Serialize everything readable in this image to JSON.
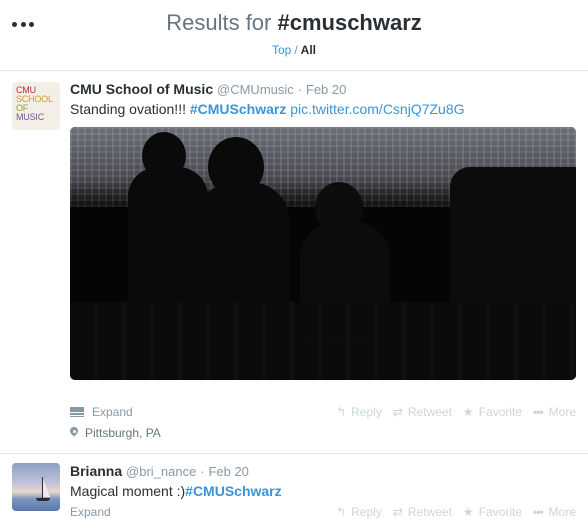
{
  "header": {
    "title_prefix": "Results for ",
    "title_query": "#cmuschwarz",
    "tabs": [
      {
        "label": "Top"
      },
      {
        "label": "All"
      }
    ],
    "tab_separator": "/"
  },
  "tweets": [
    {
      "avatar_lines": [
        "CMU",
        "SCHOOL",
        "OF",
        "MUSIC"
      ],
      "fullname": "CMU School of Music",
      "username": "@CMUmusic",
      "dot": "·",
      "time": "Feb 20",
      "text_before": "Standing ovation!!! ",
      "hashtag": "#CMUSchwarz",
      "link": "pic.twitter.com/CsnjQ7Zu8G",
      "expand_label": "Expand",
      "location": "Pittsburgh, PA",
      "actions": {
        "reply": "Reply",
        "retweet": "Retweet",
        "favorite": "Favorite",
        "more": "More"
      }
    },
    {
      "fullname": "Brianna",
      "username": "@bri_nance",
      "dot": "·",
      "time": "Feb 20",
      "text_before": "Magical moment :)",
      "hashtag": "#CMUSchwarz",
      "expand_label": "Expand",
      "actions": {
        "reply": "Reply",
        "retweet": "Retweet",
        "favorite": "Favorite",
        "more": "More"
      }
    }
  ],
  "icons": {
    "reply": "reply-icon",
    "retweet": "retweet-icon",
    "favorite": "star-icon",
    "more": "ellipsis-icon",
    "expand": "media-icon",
    "location": "location-pin-icon"
  },
  "colors": {
    "link": "#3b94d9",
    "muted": "#8899a6",
    "action": "#ccd6dd",
    "text": "#292f33"
  }
}
